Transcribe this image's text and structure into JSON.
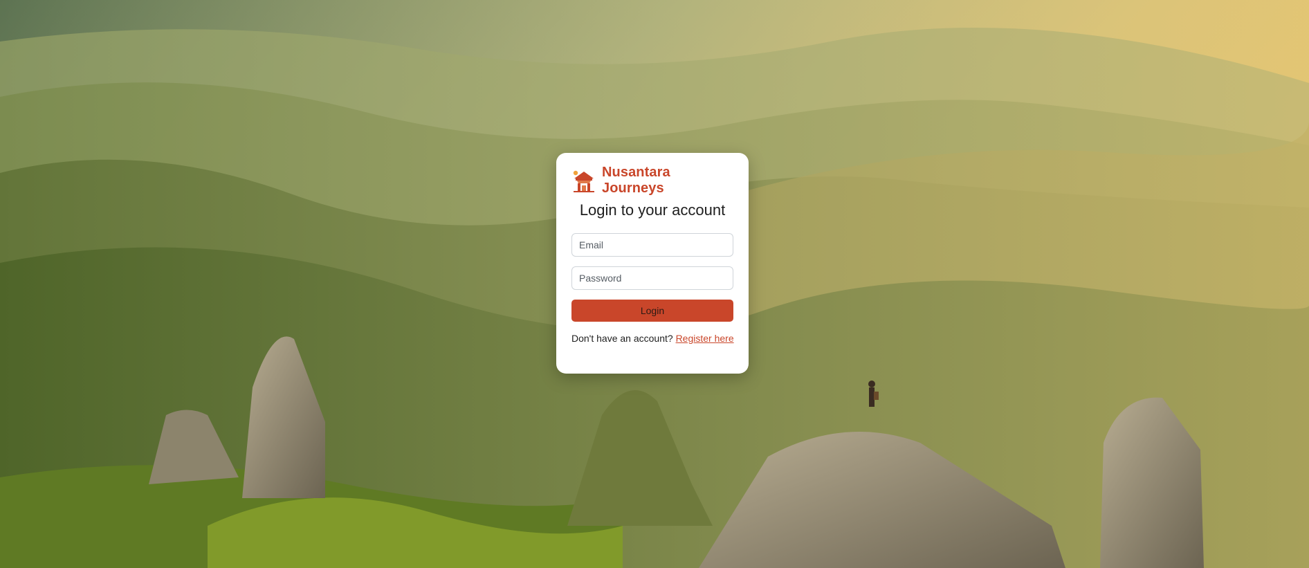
{
  "brand": {
    "name": "Nusantara Journeys",
    "logo_icon": "temple-gate-icon",
    "color": "#c9462a"
  },
  "login_form": {
    "title": "Login to your account",
    "email_placeholder": "Email",
    "email_value": "",
    "password_placeholder": "Password",
    "password_value": "",
    "login_label": "Login",
    "register_prompt": "Don't have an account?",
    "register_link": "Register here"
  },
  "colors": {
    "accent": "#c9462a",
    "card_background": "#ffffff"
  }
}
